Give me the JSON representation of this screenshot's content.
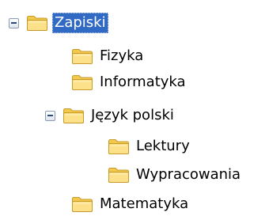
{
  "tree": {
    "root": {
      "label": "Zapiski",
      "expanded": true,
      "selected": true
    },
    "fizyka": {
      "label": "Fizyka"
    },
    "informatyka": {
      "label": "Informatyka"
    },
    "jezyk_polski": {
      "label": "Język polski",
      "expanded": true,
      "children": [
        {
          "label": "Lektury"
        },
        {
          "label": "Wypracowania"
        }
      ]
    },
    "matematyka": {
      "label": "Matematyka"
    }
  },
  "icons": {
    "expander": "minus-box-icon",
    "folder": "folder-icon"
  },
  "colors": {
    "selection": "#316ac5",
    "folder_fill": "#f7d774",
    "folder_border": "#c89a28",
    "expander_border": "#8a9bb3"
  }
}
